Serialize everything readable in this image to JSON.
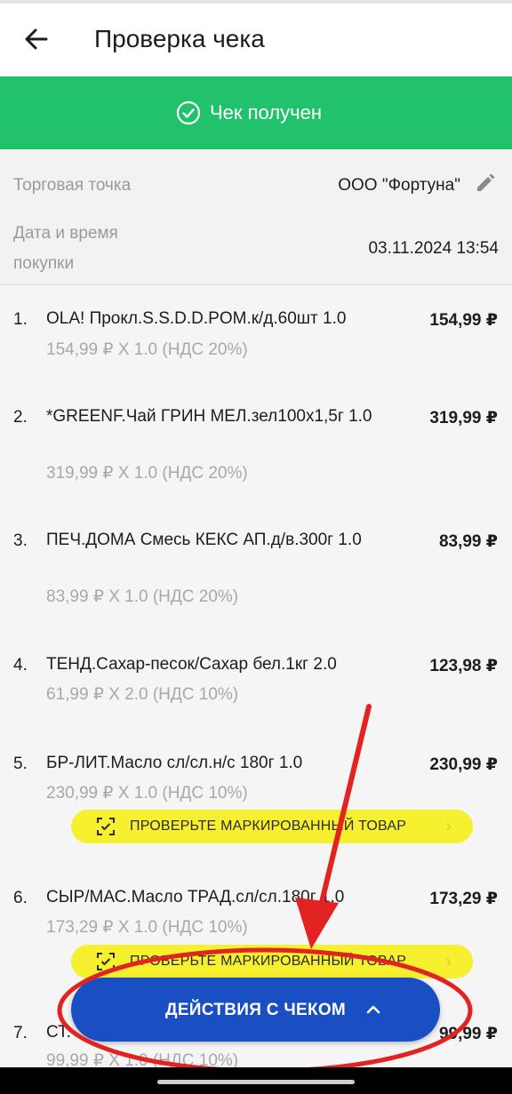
{
  "appbar": {
    "title": "Проверка чека"
  },
  "status": {
    "text": "Чек получен",
    "color": "#21c26b"
  },
  "info": {
    "store_label": "Торговая точка",
    "store_value": "ООО \"Фортуна\"",
    "datetime_label_line1": "Дата и время",
    "datetime_label_line2": "покупки",
    "datetime_value": "03.11.2024 13:54"
  },
  "items": [
    {
      "num": "1.",
      "name": "OLA! Прокл.S.S.D.D.POM.к/д.60шт 1.0",
      "sub": "154,99 ₽ X 1.0  (НДС 20%)",
      "total": "154,99 ₽"
    },
    {
      "num": "2.",
      "name": "*GREENF.Чай ГРИН МЕЛ.зел100х1,5г 1.0",
      "sub": "319,99 ₽ X 1.0  (НДС 20%)",
      "total": "319,99 ₽"
    },
    {
      "num": "3.",
      "name": "ПЕЧ.ДОМА Смесь КЕКС АП.д/в.300г 1.0",
      "sub": "83,99 ₽ X 1.0  (НДС 20%)",
      "total": "83,99 ₽"
    },
    {
      "num": "4.",
      "name": "ТЕНД.Сахар-песок/Сахар бел.1кг 2.0",
      "sub": "61,99 ₽ X 2.0  (НДС 10%)",
      "total": "123,98 ₽"
    },
    {
      "num": "5.",
      "name": "БР-ЛИТ.Масло сл/сл.н/с 180г 1.0",
      "sub": "230,99 ₽ X 1.0  (НДС 10%)",
      "total": "230,99 ₽"
    },
    {
      "num": "6.",
      "name": "СЫР/МАС.Масло ТРАД.сл/сл.180г 1.0",
      "sub": "173,29 ₽ X 1.0  (НДС 10%)",
      "total": "173,29 ₽"
    },
    {
      "num": "7.",
      "name": "СТ.",
      "sub": "99,99 ₽ X 1.0  (НДС 10%)",
      "total": "99,99 ₽"
    }
  ],
  "mark_button": {
    "label": "ПРОВЕРЬТЕ МАРКИРОВАННЫЙ ТОВАР",
    "color": "#f7f02f"
  },
  "actions_button": {
    "label": "ДЕЙСТВИЯ С ЧЕКОМ",
    "color": "#1a4fc4"
  },
  "annotation": {
    "color": "#e32222",
    "shape": "arrow pointing to an ellipse around the actions button"
  }
}
